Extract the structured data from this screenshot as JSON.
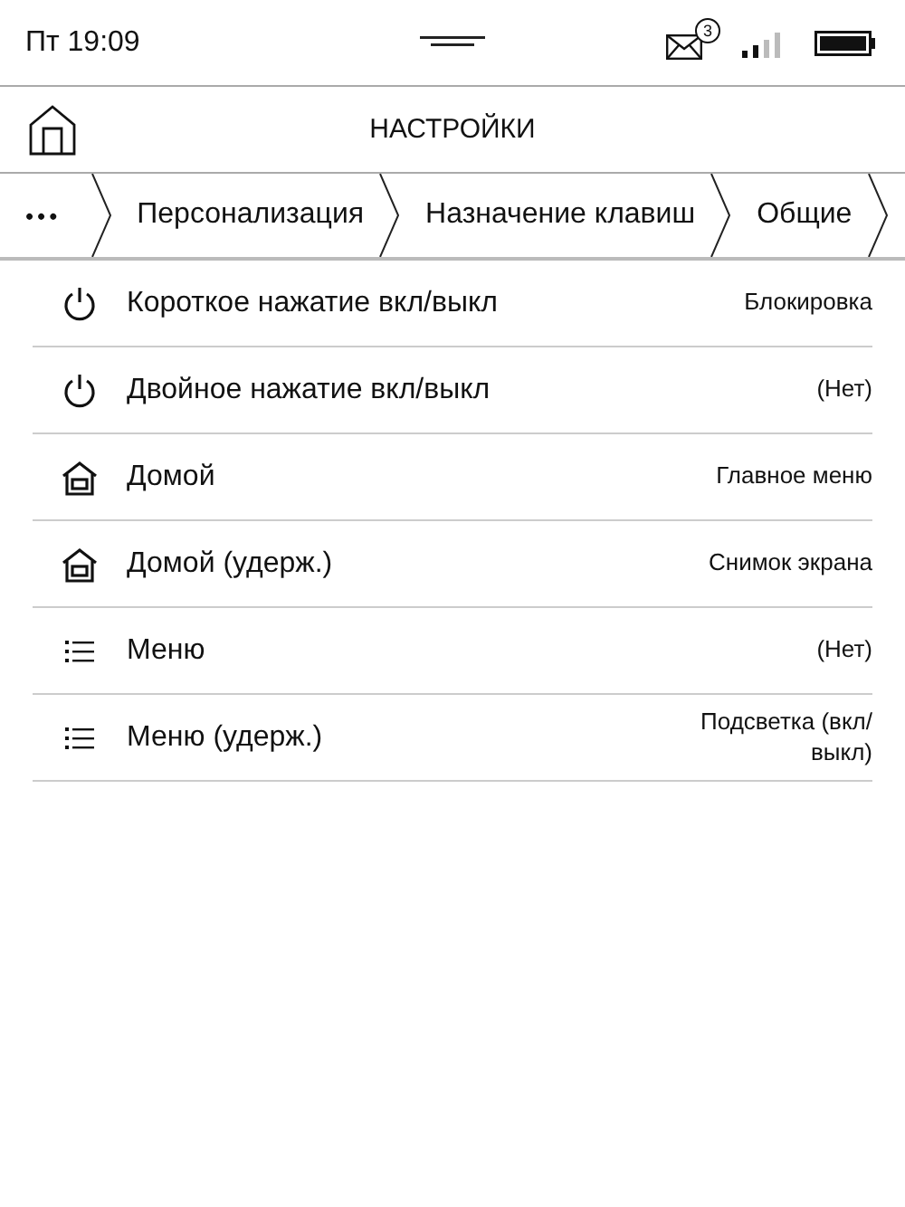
{
  "status_bar": {
    "time": "Пт 19:09",
    "mail_count": "3"
  },
  "header": {
    "title": "НАСТРОЙКИ"
  },
  "breadcrumbs": [
    {
      "label": "•••"
    },
    {
      "label": "Персонализация"
    },
    {
      "label": "Назначение клавиш"
    },
    {
      "label": "Общие"
    }
  ],
  "rows": [
    {
      "kind": "power",
      "label": "Короткое нажатие вкл/выкл",
      "value": "Блокировка"
    },
    {
      "kind": "power",
      "label": "Двойное нажатие вкл/выкл",
      "value": "(Нет)"
    },
    {
      "kind": "home",
      "label": "Домой",
      "value": "Главное меню"
    },
    {
      "kind": "home",
      "label": "Домой (удерж.)",
      "value": "Снимок экрана"
    },
    {
      "kind": "menu",
      "label": "Меню",
      "value": "(Нет)"
    },
    {
      "kind": "menu",
      "label": "Меню (удерж.)",
      "value": "Подсветка (вкл/выкл)"
    }
  ]
}
